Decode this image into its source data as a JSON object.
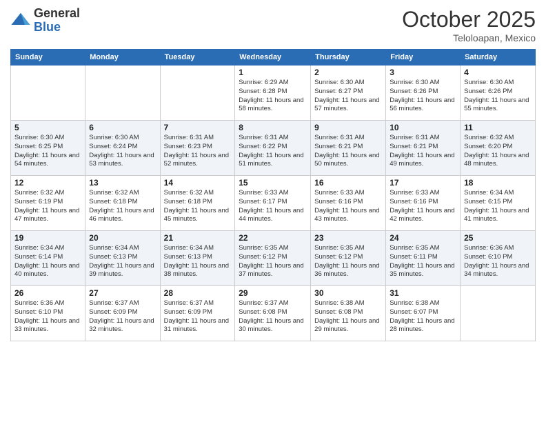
{
  "logo": {
    "general": "General",
    "blue": "Blue"
  },
  "title": "October 2025",
  "location": "Teloloapan, Mexico",
  "days_of_week": [
    "Sunday",
    "Monday",
    "Tuesday",
    "Wednesday",
    "Thursday",
    "Friday",
    "Saturday"
  ],
  "weeks": [
    [
      {
        "day": "",
        "sunrise": "",
        "sunset": "",
        "daylight": ""
      },
      {
        "day": "",
        "sunrise": "",
        "sunset": "",
        "daylight": ""
      },
      {
        "day": "",
        "sunrise": "",
        "sunset": "",
        "daylight": ""
      },
      {
        "day": "1",
        "sunrise": "Sunrise: 6:29 AM",
        "sunset": "Sunset: 6:28 PM",
        "daylight": "Daylight: 11 hours and 58 minutes."
      },
      {
        "day": "2",
        "sunrise": "Sunrise: 6:30 AM",
        "sunset": "Sunset: 6:27 PM",
        "daylight": "Daylight: 11 hours and 57 minutes."
      },
      {
        "day": "3",
        "sunrise": "Sunrise: 6:30 AM",
        "sunset": "Sunset: 6:26 PM",
        "daylight": "Daylight: 11 hours and 56 minutes."
      },
      {
        "day": "4",
        "sunrise": "Sunrise: 6:30 AM",
        "sunset": "Sunset: 6:26 PM",
        "daylight": "Daylight: 11 hours and 55 minutes."
      }
    ],
    [
      {
        "day": "5",
        "sunrise": "Sunrise: 6:30 AM",
        "sunset": "Sunset: 6:25 PM",
        "daylight": "Daylight: 11 hours and 54 minutes."
      },
      {
        "day": "6",
        "sunrise": "Sunrise: 6:30 AM",
        "sunset": "Sunset: 6:24 PM",
        "daylight": "Daylight: 11 hours and 53 minutes."
      },
      {
        "day": "7",
        "sunrise": "Sunrise: 6:31 AM",
        "sunset": "Sunset: 6:23 PM",
        "daylight": "Daylight: 11 hours and 52 minutes."
      },
      {
        "day": "8",
        "sunrise": "Sunrise: 6:31 AM",
        "sunset": "Sunset: 6:22 PM",
        "daylight": "Daylight: 11 hours and 51 minutes."
      },
      {
        "day": "9",
        "sunrise": "Sunrise: 6:31 AM",
        "sunset": "Sunset: 6:21 PM",
        "daylight": "Daylight: 11 hours and 50 minutes."
      },
      {
        "day": "10",
        "sunrise": "Sunrise: 6:31 AM",
        "sunset": "Sunset: 6:21 PM",
        "daylight": "Daylight: 11 hours and 49 minutes."
      },
      {
        "day": "11",
        "sunrise": "Sunrise: 6:32 AM",
        "sunset": "Sunset: 6:20 PM",
        "daylight": "Daylight: 11 hours and 48 minutes."
      }
    ],
    [
      {
        "day": "12",
        "sunrise": "Sunrise: 6:32 AM",
        "sunset": "Sunset: 6:19 PM",
        "daylight": "Daylight: 11 hours and 47 minutes."
      },
      {
        "day": "13",
        "sunrise": "Sunrise: 6:32 AM",
        "sunset": "Sunset: 6:18 PM",
        "daylight": "Daylight: 11 hours and 46 minutes."
      },
      {
        "day": "14",
        "sunrise": "Sunrise: 6:32 AM",
        "sunset": "Sunset: 6:18 PM",
        "daylight": "Daylight: 11 hours and 45 minutes."
      },
      {
        "day": "15",
        "sunrise": "Sunrise: 6:33 AM",
        "sunset": "Sunset: 6:17 PM",
        "daylight": "Daylight: 11 hours and 44 minutes."
      },
      {
        "day": "16",
        "sunrise": "Sunrise: 6:33 AM",
        "sunset": "Sunset: 6:16 PM",
        "daylight": "Daylight: 11 hours and 43 minutes."
      },
      {
        "day": "17",
        "sunrise": "Sunrise: 6:33 AM",
        "sunset": "Sunset: 6:16 PM",
        "daylight": "Daylight: 11 hours and 42 minutes."
      },
      {
        "day": "18",
        "sunrise": "Sunrise: 6:34 AM",
        "sunset": "Sunset: 6:15 PM",
        "daylight": "Daylight: 11 hours and 41 minutes."
      }
    ],
    [
      {
        "day": "19",
        "sunrise": "Sunrise: 6:34 AM",
        "sunset": "Sunset: 6:14 PM",
        "daylight": "Daylight: 11 hours and 40 minutes."
      },
      {
        "day": "20",
        "sunrise": "Sunrise: 6:34 AM",
        "sunset": "Sunset: 6:13 PM",
        "daylight": "Daylight: 11 hours and 39 minutes."
      },
      {
        "day": "21",
        "sunrise": "Sunrise: 6:34 AM",
        "sunset": "Sunset: 6:13 PM",
        "daylight": "Daylight: 11 hours and 38 minutes."
      },
      {
        "day": "22",
        "sunrise": "Sunrise: 6:35 AM",
        "sunset": "Sunset: 6:12 PM",
        "daylight": "Daylight: 11 hours and 37 minutes."
      },
      {
        "day": "23",
        "sunrise": "Sunrise: 6:35 AM",
        "sunset": "Sunset: 6:12 PM",
        "daylight": "Daylight: 11 hours and 36 minutes."
      },
      {
        "day": "24",
        "sunrise": "Sunrise: 6:35 AM",
        "sunset": "Sunset: 6:11 PM",
        "daylight": "Daylight: 11 hours and 35 minutes."
      },
      {
        "day": "25",
        "sunrise": "Sunrise: 6:36 AM",
        "sunset": "Sunset: 6:10 PM",
        "daylight": "Daylight: 11 hours and 34 minutes."
      }
    ],
    [
      {
        "day": "26",
        "sunrise": "Sunrise: 6:36 AM",
        "sunset": "Sunset: 6:10 PM",
        "daylight": "Daylight: 11 hours and 33 minutes."
      },
      {
        "day": "27",
        "sunrise": "Sunrise: 6:37 AM",
        "sunset": "Sunset: 6:09 PM",
        "daylight": "Daylight: 11 hours and 32 minutes."
      },
      {
        "day": "28",
        "sunrise": "Sunrise: 6:37 AM",
        "sunset": "Sunset: 6:09 PM",
        "daylight": "Daylight: 11 hours and 31 minutes."
      },
      {
        "day": "29",
        "sunrise": "Sunrise: 6:37 AM",
        "sunset": "Sunset: 6:08 PM",
        "daylight": "Daylight: 11 hours and 30 minutes."
      },
      {
        "day": "30",
        "sunrise": "Sunrise: 6:38 AM",
        "sunset": "Sunset: 6:08 PM",
        "daylight": "Daylight: 11 hours and 29 minutes."
      },
      {
        "day": "31",
        "sunrise": "Sunrise: 6:38 AM",
        "sunset": "Sunset: 6:07 PM",
        "daylight": "Daylight: 11 hours and 28 minutes."
      },
      {
        "day": "",
        "sunrise": "",
        "sunset": "",
        "daylight": ""
      }
    ]
  ]
}
